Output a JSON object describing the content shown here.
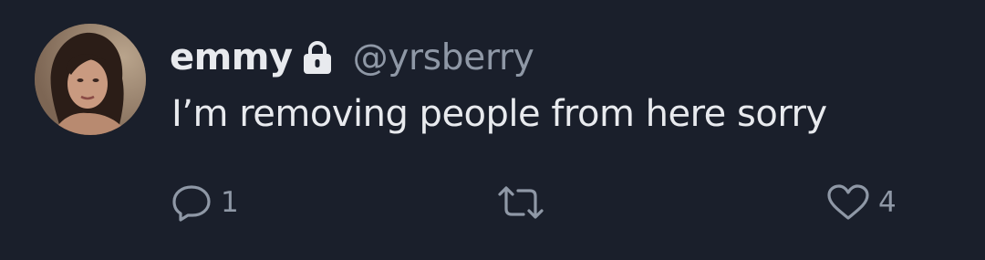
{
  "tweet": {
    "display_name": "emmy",
    "handle": "@yrsberry",
    "text": "I’m removing people from here sorry",
    "protected_icon": "lock-icon",
    "actions": {
      "reply": {
        "icon": "reply-icon",
        "count": "1"
      },
      "retweet": {
        "icon": "retweet-icon"
      },
      "like": {
        "icon": "heart-icon",
        "count": "4"
      }
    }
  },
  "colors": {
    "background": "#1a1f2b",
    "primary_text": "#e8eaee",
    "secondary_text": "#8f98a6"
  }
}
